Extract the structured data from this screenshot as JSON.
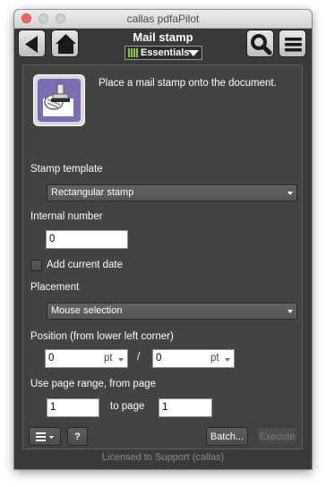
{
  "window": {
    "title": "callas pdfaPilot"
  },
  "toolbar": {
    "back_icon": "back-arrow-icon",
    "home_icon": "home-icon",
    "search_icon": "magnifier-icon",
    "menu_icon": "hamburger-menu-icon",
    "pane_title": "Mail stamp",
    "profile_dropdown": {
      "label": "Essentials",
      "icon": "essentials-bars-icon"
    }
  },
  "panel": {
    "description": "Place a mail stamp onto the document.",
    "stamp_icon": "mail-stamp-icon",
    "stamp_template": {
      "label": "Stamp template",
      "value": "Rectangular stamp"
    },
    "internal_number": {
      "label": "Internal number",
      "value": "0"
    },
    "add_date": {
      "label": "Add current date",
      "checked": false
    },
    "placement": {
      "label": "Placement",
      "value": "Mouse selection"
    },
    "position": {
      "label": "Position (from lower left corner)",
      "x_value": "0",
      "x_unit": "pt",
      "separator": "/",
      "y_value": "0",
      "y_unit": "pt"
    },
    "page_range": {
      "label": "Use page range, from page",
      "from_value": "1",
      "to_label": "to page",
      "to_value": "1"
    },
    "buttons": {
      "options_icon": "list-menu-icon",
      "help_label": "?",
      "batch_label": "Batch...",
      "execute_label": "Execute"
    }
  },
  "status": {
    "license_text": "Licensed to Support (callas)"
  },
  "colors": {
    "accent_green": "#8bc53f",
    "background": "#3a3a3a",
    "panel": "#434343"
  }
}
